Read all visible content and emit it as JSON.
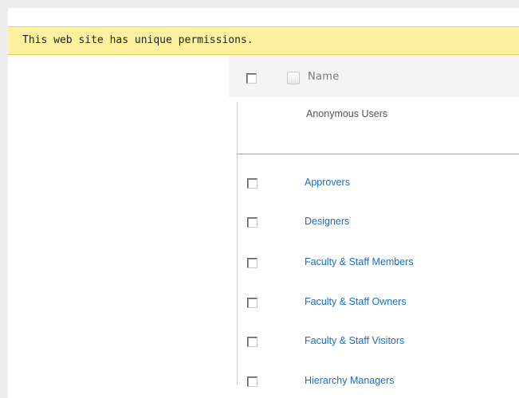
{
  "banner": {
    "text": "This web site has unique permissions."
  },
  "grid": {
    "column_header": "Name",
    "anonymous_row": "Anonymous Users",
    "groups": [
      {
        "label": "Approvers"
      },
      {
        "label": "Designers"
      },
      {
        "label": "Faculty & Staff Members"
      },
      {
        "label": "Faculty & Staff Owners"
      },
      {
        "label": "Faculty & Staff Visitors"
      },
      {
        "label": "Hierarchy Managers"
      }
    ]
  },
  "colors": {
    "banner_bg": "#fdf19f",
    "link": "#1a6cc2"
  }
}
